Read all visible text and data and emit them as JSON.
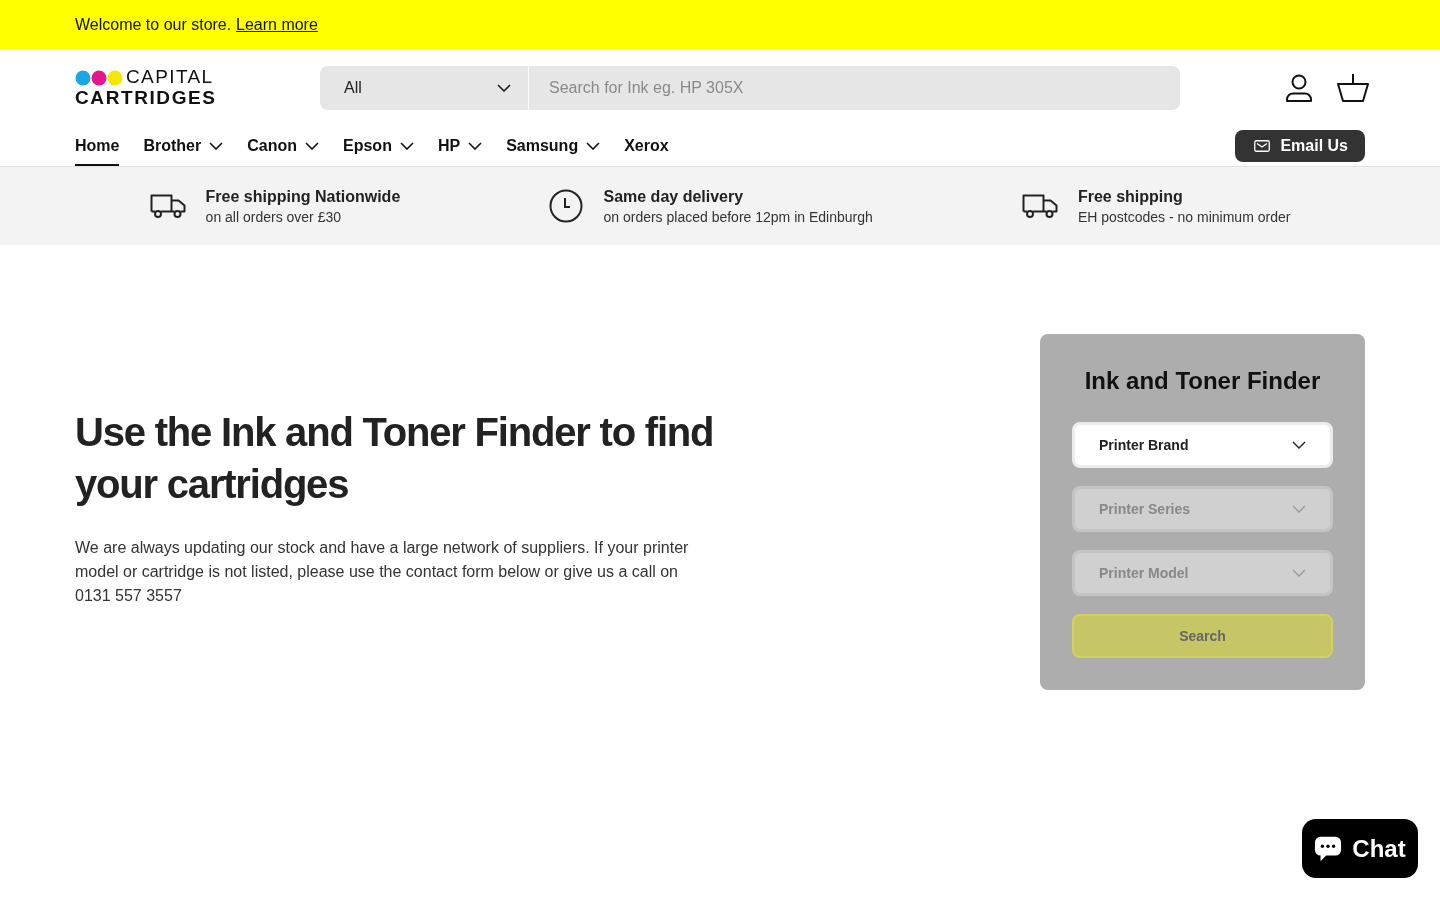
{
  "announcement": {
    "text": "Welcome to our store.",
    "link": "Learn more"
  },
  "header": {
    "logo": {
      "line_1": "CAPITAL",
      "line_2": "CARTRIDGES"
    },
    "search": {
      "category": "All",
      "placeholder": "Search for Ink eg. HP 305X"
    }
  },
  "nav": {
    "items": [
      {
        "label": "Home",
        "selected": true,
        "dropdown": false
      },
      {
        "label": "Brother",
        "selected": false,
        "dropdown": true
      },
      {
        "label": "Canon",
        "selected": false,
        "dropdown": true
      },
      {
        "label": "Epson",
        "selected": false,
        "dropdown": true
      },
      {
        "label": "HP",
        "selected": false,
        "dropdown": true
      },
      {
        "label": "Samsung",
        "selected": false,
        "dropdown": true
      },
      {
        "label": "Xerox",
        "selected": false,
        "dropdown": false
      }
    ],
    "email_button": "Email Us"
  },
  "features": [
    {
      "kind": "truck",
      "title": "Free shipping Nationwide",
      "subtitle": "on all orders over £30"
    },
    {
      "kind": "clock",
      "title": "Same day delivery",
      "subtitle": "on orders placed before 12pm in Edinburgh"
    },
    {
      "kind": "truck",
      "title": "Free shipping",
      "subtitle": "EH postcodes - no minimum order"
    }
  ],
  "hero": {
    "title": "Use the Ink and Toner Finder to find your cartridges",
    "body": "We are always updating our stock and have a large network of suppliers. If your printer model or cartridge is not listed, please use the contact form below or give us a call on 0131 557 3557"
  },
  "finder": {
    "title": "Ink and Toner Finder",
    "selects": [
      {
        "label": "Printer Brand",
        "disabled": false
      },
      {
        "label": "Printer Series",
        "disabled": true
      },
      {
        "label": "Printer Model",
        "disabled": true
      }
    ],
    "search_button": {
      "label": "Search",
      "disabled": true
    }
  },
  "chat": {
    "label": "Chat"
  }
}
